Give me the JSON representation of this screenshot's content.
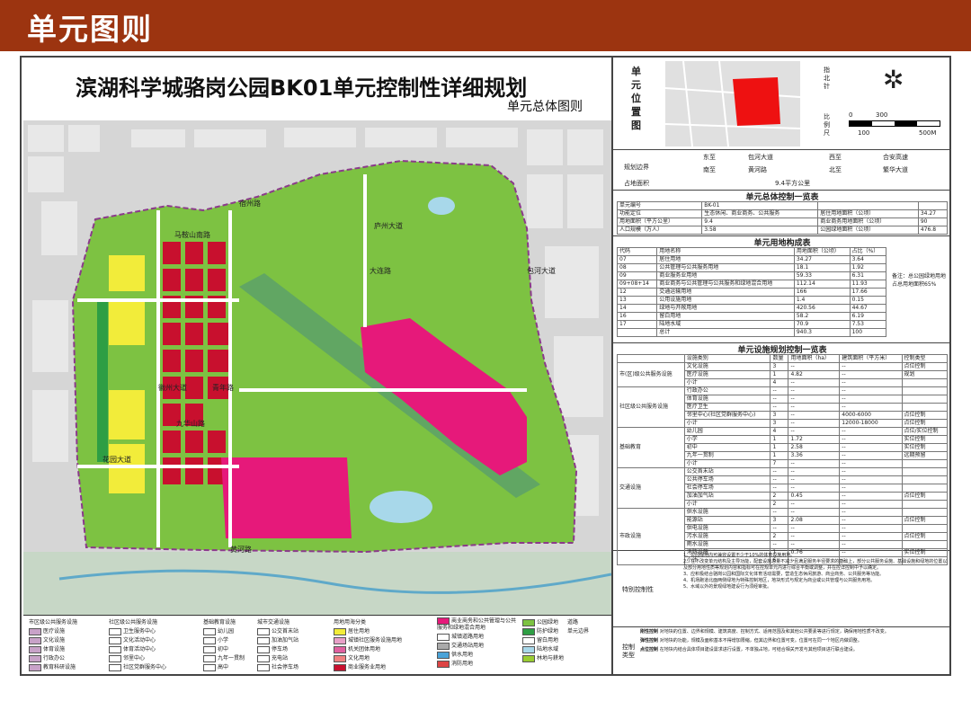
{
  "header": {
    "title": "单元图则"
  },
  "map": {
    "title": "滨湖科学城骆岗公园BK01单元控制性详细规划",
    "subtitle": "单元总体图则",
    "road_labels": [
      "宿州路",
      "马鞍山南路",
      "徽州大道",
      "包河大道",
      "九华山路",
      "大连路",
      "青年路",
      "庐州大道",
      "花园大道",
      "黄河路",
      "巢湖南路",
      "繁华大道",
      "东亚大道",
      "双岗路"
    ]
  },
  "location": {
    "label": "单元位置图",
    "north_label": "指北针",
    "scale_label": "比例尺",
    "scale_values": [
      "0",
      "300",
      "100",
      "500M"
    ]
  },
  "boundary": {
    "label": "规划边界",
    "rows": [
      {
        "d1": "东至",
        "v1": "包河大道",
        "d2": "西至",
        "v2": "合安高速"
      },
      {
        "d1": "南至",
        "v1": "黄河路",
        "d2": "北至",
        "v2": "繁华大道"
      }
    ],
    "area_label": "占地面积",
    "area_value": "9.4平方公里"
  },
  "control_title": "单元总体控制一览表",
  "control_rows": [
    [
      "单元编号",
      "BK-01",
      "",
      ""
    ],
    [
      "功能定位",
      "生态休闲、商业商务、公共服务",
      "居住用地面积（公顷）",
      "34.27"
    ],
    [
      "用地面积（平方公里）",
      "9.4",
      "商业商务用地面积（公顷）",
      "90"
    ],
    [
      "人口规模（万人）",
      "3.58",
      "公园绿地面积（公顷）",
      "476.8"
    ]
  ],
  "landuse_title": "单元用地构成表",
  "landuse_header": [
    "代码",
    "用地名称",
    "用地面积（公顷）",
    "占比（%）",
    "备注"
  ],
  "landuse_rows": [
    [
      "07",
      "居住用地",
      "34.27",
      "3.64"
    ],
    [
      "08",
      "公共管理与公共服务用地",
      "18.1",
      "1.92"
    ],
    [
      "09",
      "商业服务业用地",
      "59.33",
      "6.31"
    ],
    [
      "09+08+14",
      "商业商务与公共管理与公共服务和绿地混合用地",
      "112.14",
      "11.93"
    ],
    [
      "12",
      "交通运输用地",
      "166",
      "17.66"
    ],
    [
      "13",
      "公用设施用地",
      "1.4",
      "0.15"
    ],
    [
      "14",
      "绿地与开敞用地",
      "420.56",
      "44.67"
    ],
    [
      "16",
      "留白用地",
      "58.2",
      "6.19"
    ],
    [
      "17",
      "陆地水域",
      "70.9",
      "7.53"
    ],
    [
      "",
      "总计",
      "940.3",
      "100"
    ]
  ],
  "landuse_note": "备注：总公园绿地用地占总用地面积65%",
  "facility_title": "单元设施规划控制一览表",
  "facility_header": [
    "",
    "设施类别",
    "数量",
    "用地面积（ha）",
    "建筑面积（平方米）",
    "控制类型"
  ],
  "facility_groups": [
    {
      "name": "市(区)级公共服务设施",
      "rows": [
        [
          "文化设施",
          "3",
          "--",
          "--",
          "点位控制"
        ],
        [
          "医疗设施",
          "1",
          "4.82",
          "--",
          "规划"
        ],
        [
          "小计",
          "4",
          "--",
          "--",
          ""
        ]
      ]
    },
    {
      "name": "社区级公共服务设施",
      "rows": [
        [
          "行政办公",
          "--",
          "--",
          "--",
          ""
        ],
        [
          "体育设施",
          "--",
          "--",
          "--",
          ""
        ],
        [
          "医疗卫生",
          "--",
          "--",
          "--",
          ""
        ],
        [
          "邻里中心(社区党群服务中心)",
          "3",
          "--",
          "4000-6000",
          "点位控制"
        ],
        [
          "小计",
          "3",
          "--",
          "12000-18000",
          "点位控制"
        ]
      ]
    },
    {
      "name": "基础教育",
      "rows": [
        [
          "幼儿园",
          "4",
          "--",
          "--",
          "点位/实位控制"
        ],
        [
          "小学",
          "1",
          "1.72",
          "--",
          "实位控制"
        ],
        [
          "初中",
          "1",
          "2.58",
          "--",
          "实位控制"
        ],
        [
          "九年一贯制",
          "1",
          "3.36",
          "--",
          "远期预留"
        ],
        [
          "小计",
          "7",
          "--",
          "--",
          ""
        ]
      ]
    },
    {
      "name": "交通设施",
      "rows": [
        [
          "公交首末站",
          "--",
          "--",
          "--",
          ""
        ],
        [
          "公共停车场",
          "--",
          "--",
          "--",
          ""
        ],
        [
          "社会停车场",
          "--",
          "--",
          "--",
          ""
        ],
        [
          "加油加气站",
          "2",
          "0.45",
          "--",
          "点位控制"
        ],
        [
          "小计",
          "2",
          "--",
          "--",
          ""
        ]
      ]
    },
    {
      "name": "市政设施",
      "rows": [
        [
          "供水设施",
          "--",
          "--",
          "--",
          ""
        ],
        [
          "能源站",
          "3",
          "2.08",
          "--",
          "点位控制"
        ],
        [
          "供电设施",
          "--",
          "--",
          "--",
          ""
        ],
        [
          "污水设施",
          "2",
          "--",
          "--",
          "点位控制"
        ],
        [
          "雨水设施",
          "--",
          "--",
          "--",
          ""
        ],
        [
          "消防设施",
          "1",
          "0.76",
          "--",
          "实位控制"
        ],
        [
          "小计",
          "6",
          "--",
          "--",
          ""
        ]
      ]
    }
  ],
  "special_title": "特别控制性",
  "special_notes": [
    "1、公园绿地内可兼容设置不少于10%的体育设施用地。",
    "2、在不改变单元结构及主导功能，配套设施总量不减少且满足服务半径要求的基础上，部分公共服务设施、基础设施和绿地的位置以及部分用地性质等规划内容和指标可在控规单元内进行综合平衡或调整，并在控详控制中予以确定。",
    "3、应积极结合骆岗公园和国际文化体育活动需要，营造生态休闲旅游、商业商务、公共服务等功能。",
    "4、机场跑道北面两侧绿地为特殊控制地区，地块形式与规定为商业或公共管理与公共服务用地。",
    "5、水域以外的景观绿地建设行为须经审批。"
  ],
  "control_type_title": "控制类型",
  "control_types": [
    {
      "name": "刚性控制",
      "desc": "对地块的位置、边界和规模、建筑高度、控制方式、适用范围及和其他公共要素等进行规定，确保用地性质不改变。"
    },
    {
      "name": "弹性控制",
      "desc": "对地块的功能，规模及面积基本不得增加限缩，但其边界和位置可变。位置可在同一个地区内做调整。"
    },
    {
      "name": "点位控制",
      "desc": "在地块内结合具体项目建设需求进行设置，不单独占地，可结合相关开发与其他项目进行联合建设。"
    }
  ],
  "legend": {
    "groups": [
      {
        "title": "市区级公共服务设施",
        "items": [
          "医疗设施",
          "文化设施",
          "体育设施",
          "行政办公",
          "教育科研设施"
        ]
      },
      {
        "title": "社区级公共服务设施",
        "items": [
          "卫生服务中心",
          "文化活动中心",
          "体育活动中心",
          "邻里中心",
          "社区党群服务中心"
        ]
      },
      {
        "title": "基础教育设施",
        "items": [
          "幼儿园",
          "小学",
          "初中",
          "九年一贯制",
          "高中"
        ]
      },
      {
        "title": "城市交通设施",
        "items": [
          "公交首末站",
          "加油加气站",
          "停车场",
          "充电站",
          "社会停车场"
        ]
      },
      {
        "title": "用地用海分类",
        "items": [
          "居住用地",
          "城镇社区服务设施用地",
          "机关团体用地",
          "文化用地",
          "医疗卫生用地",
          "商业服务业用地"
        ]
      },
      {
        "title": "混合用地",
        "items": [
          "商业商务和公共管理与公共服务和绿地混合用地",
          "城镇道路用地",
          "交通场站用地",
          "供水用地",
          "消防用地"
        ]
      },
      {
        "title": "绿地",
        "items": [
          "公园绿地",
          "防护绿地",
          "留白用地",
          "陆地水域",
          "林地与耕地"
        ]
      }
    ],
    "boundary_label": "单元边界",
    "road_label": "道路"
  },
  "colors": {
    "banner": "#9c3410",
    "residential": "#f2ec3a",
    "commercial": "#c8102e",
    "mixed": "#e6197a",
    "park": "#7dc242",
    "water": "#a8d8ea",
    "public_service": "#c8a2c8",
    "road": "#ffffff",
    "background_city": "#d9d9d9"
  }
}
